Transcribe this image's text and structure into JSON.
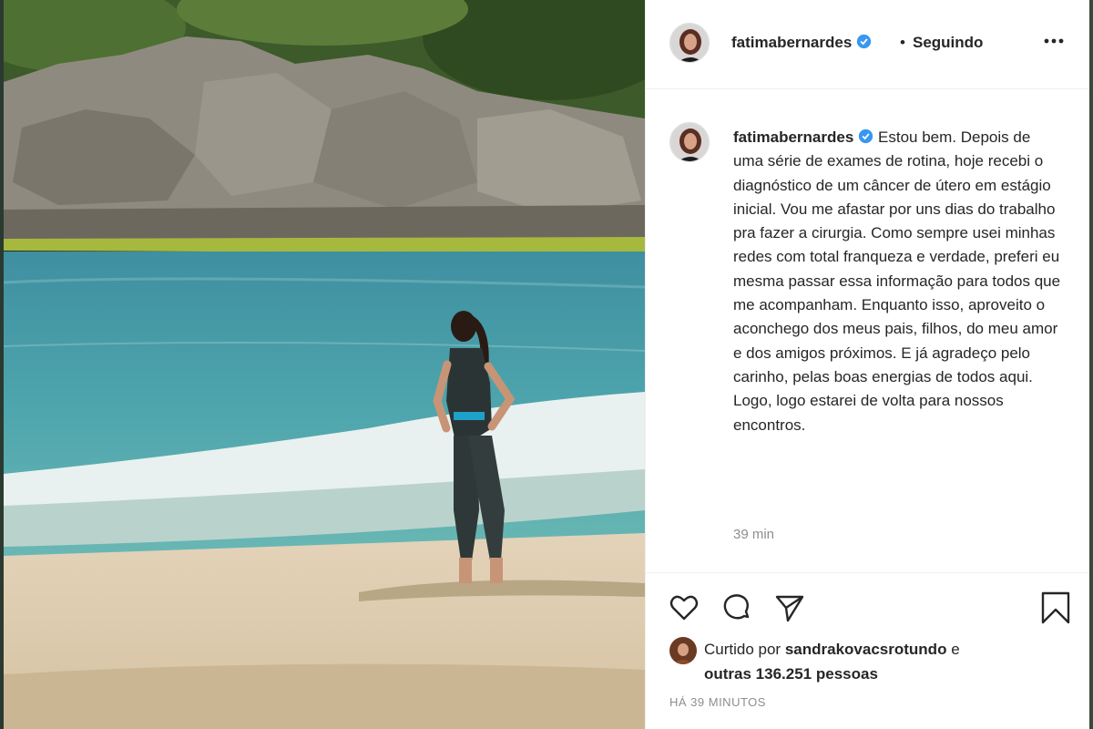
{
  "post": {
    "username": "fatimabernardes",
    "separator": "•",
    "follow_status": "Seguindo",
    "caption_intro": "Estou bem.",
    "caption_body": "Depois de uma série de exames de rotina, hoje recebi o diagnóstico de um câncer de útero em estágio inicial. Vou me afastar por uns dias do trabalho pra fazer a cirurgia. Como sempre usei minhas redes com total franqueza e verdade, preferi eu mesma passar essa informação para todos que me acompanham. Enquanto isso, aproveito o aconchego dos meus pais, filhos, do meu amor e dos amigos próximos. E já agradeço pelo carinho, pelas boas energias de todos aqui. Logo, logo estarei de volta para nossos encontros.",
    "caption_time": "39 min"
  },
  "likes": {
    "prefix": "Curtido por",
    "liker": "sandrakovacsrotundo",
    "conj": "e",
    "others": "outras 136.251 pessoas"
  },
  "timestamp": "HÁ 39 MINUTOS",
  "icons": {
    "verified": "verified-badge-icon",
    "more": "more-options-icon",
    "like": "heart-icon",
    "comment": "comment-icon",
    "share": "share-icon",
    "save": "bookmark-icon"
  },
  "colors": {
    "verified": "#3897f0",
    "text": "#262626",
    "muted": "#8e8e8e"
  }
}
